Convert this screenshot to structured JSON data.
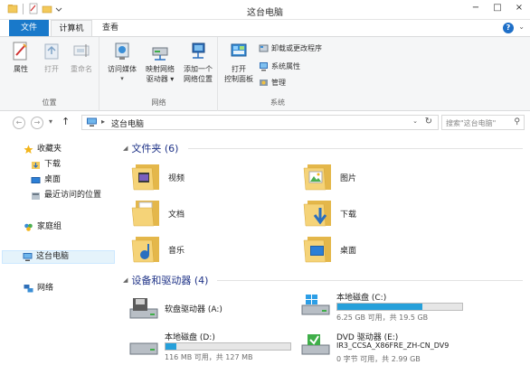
{
  "window": {
    "title": "这台电脑",
    "minimize": "−",
    "maximize": "□",
    "close": "×"
  },
  "tabs": {
    "file": "文件",
    "computer": "计算机",
    "view": "查看",
    "ribbon_toggle": "⌄",
    "help": "?"
  },
  "ribbon": {
    "location": {
      "label": "位置",
      "properties": "属性",
      "open": "打开",
      "rename": "重命名"
    },
    "network": {
      "label": "网络",
      "access_media": "访问媒体",
      "map_drive_line1": "映射网络",
      "map_drive_line2": "驱动器 ▾",
      "add_location_line1": "添加一个",
      "add_location_line2": "网络位置"
    },
    "system": {
      "label": "系统",
      "open_cp_line1": "打开",
      "open_cp_line2": "控制面板",
      "uninstall": "卸载或更改程序",
      "sys_props": "系统属性",
      "manage": "管理"
    }
  },
  "address": {
    "back": "←",
    "forward": "→",
    "recent": "▾",
    "up": "↑",
    "path": "这台电脑",
    "chevron": "▸",
    "dropdown": "⌄",
    "refresh": "↻",
    "search_placeholder": "搜索\"这台电脑\"",
    "search_icon": "⚲"
  },
  "navpane": {
    "favorites": "收藏夹",
    "downloads": "下载",
    "desktop": "桌面",
    "recent": "最近访问的位置",
    "homegroup": "家庭组",
    "this_pc": "这台电脑",
    "network": "网络"
  },
  "content": {
    "folders_header": "文件夹 (6)",
    "folders": [
      {
        "name": "视频",
        "icon": "videos-folder-icon"
      },
      {
        "name": "图片",
        "icon": "pictures-folder-icon"
      },
      {
        "name": "文档",
        "icon": "documents-folder-icon"
      },
      {
        "name": "下载",
        "icon": "downloads-folder-icon"
      },
      {
        "name": "音乐",
        "icon": "music-folder-icon"
      },
      {
        "name": "桌面",
        "icon": "desktop-folder-icon"
      }
    ],
    "drives_header": "设备和驱动器 (4)",
    "drives": [
      {
        "name": "软盘驱动器 (A:)",
        "space": "",
        "fill": 0
      },
      {
        "name": "本地磁盘 (C:)",
        "space": "6.25 GB 可用，共 19.5 GB",
        "fill": 0.68
      },
      {
        "name": "本地磁盘 (D:)",
        "space": "116 MB 可用，共 127 MB",
        "fill": 0.09
      },
      {
        "name": "DVD 驱动器 (E:)",
        "sub": "IR3_CCSA_X86FRE_ZH-CN_DV9",
        "space": "0 字节 可用，共 2.99 GB"
      }
    ]
  },
  "colors": {
    "accent": "#1979ca",
    "drive_bar": "#26a0da",
    "section_header": "#1e3287",
    "folder_yellow": "#f3c95a"
  }
}
